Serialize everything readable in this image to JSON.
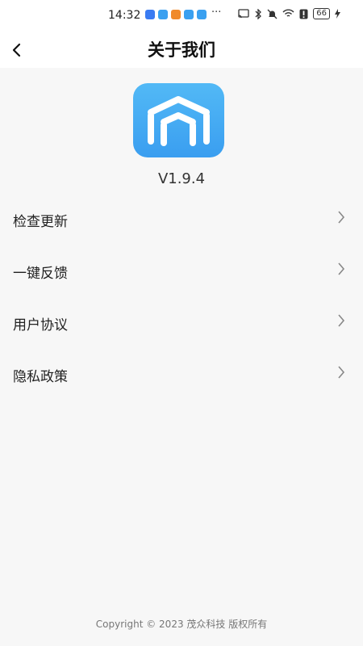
{
  "status_bar": {
    "time": "14:32",
    "more": "···",
    "battery": "66",
    "app_icon_colors": [
      "#3a7bf2",
      "#3aa0f0",
      "#f08a2a",
      "#3aa0f0",
      "#3aa0f0"
    ],
    "icons": [
      "cast-icon",
      "bluetooth-icon",
      "mute-icon",
      "wifi-icon",
      "alert-icon",
      "battery-icon",
      "charging-icon"
    ]
  },
  "header": {
    "title": "关于我们",
    "back_icon": "chevron-left-icon"
  },
  "about": {
    "logo_icon": "app-logo-icon",
    "logo_color": "#45aaf3",
    "version": "V1.9.4"
  },
  "menu": {
    "items": [
      {
        "label": "检查更新"
      },
      {
        "label": "一键反馈"
      },
      {
        "label": "用户协议"
      },
      {
        "label": "隐私政策"
      }
    ]
  },
  "footer": {
    "copyright": "Copyright © 2023 茂众科技 版权所有"
  }
}
